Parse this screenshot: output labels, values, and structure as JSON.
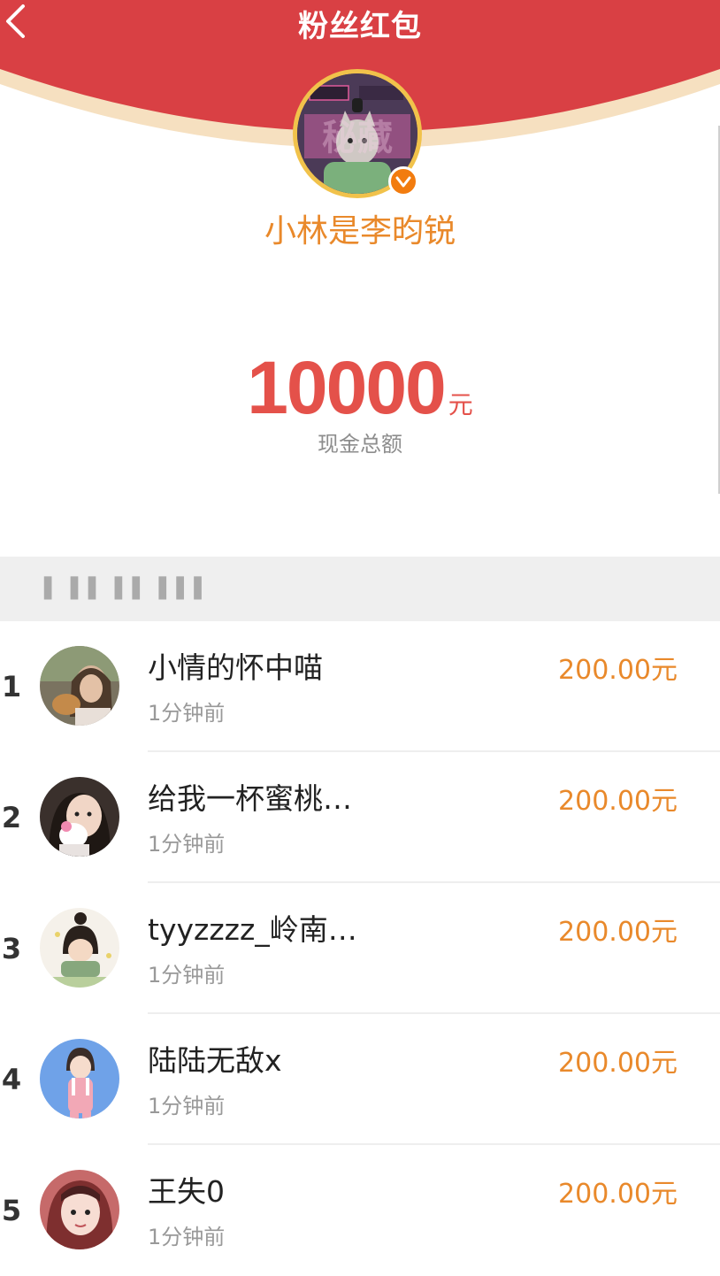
{
  "header": {
    "title": "粉丝红包",
    "back_icon": "chevron-left-icon",
    "colors": {
      "primary": "#d94044",
      "arc_highlight": "#f6e0c0"
    }
  },
  "host": {
    "name": "小林是李昀锐",
    "avatar_text": "秘藏",
    "verified_icon": "verified-badge-icon"
  },
  "summary": {
    "amount": "10000",
    "unit": "元",
    "label": "现金总额"
  },
  "section": {
    "label": "▌ ▌▌ ▌▌ ▌▌▌"
  },
  "recipients": [
    {
      "rank": "1",
      "name": "小情的怀中喵",
      "time": "1分钟前",
      "amount": "200.00元",
      "avatar_color": "#7a7360"
    },
    {
      "rank": "2",
      "name": "给我一杯蜜桃…",
      "time": "1分钟前",
      "amount": "200.00元",
      "avatar_color": "#3a302c"
    },
    {
      "rank": "3",
      "name": "tyyzzzz_岭南…",
      "time": "1分钟前",
      "amount": "200.00元",
      "avatar_color": "#f3eee6"
    },
    {
      "rank": "4",
      "name": "陆陆无敌x",
      "time": "1分钟前",
      "amount": "200.00元",
      "avatar_color": "#6fa2e8"
    },
    {
      "rank": "5",
      "name": "王失0",
      "time": "1分钟前",
      "amount": "200.00元",
      "avatar_color": "#c66a6a"
    }
  ]
}
